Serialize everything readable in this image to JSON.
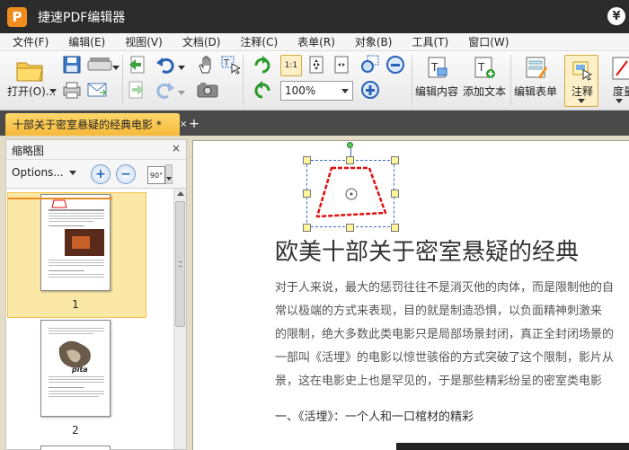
{
  "app": {
    "logo_letter": "P",
    "title": "捷速PDF编辑器",
    "currency_icon": "¥"
  },
  "menu": [
    "文件(F)",
    "编辑(E)",
    "视图(V)",
    "文档(D)",
    "注释(C)",
    "表单(R)",
    "对象(B)",
    "工具(T)",
    "窗口(W)"
  ],
  "toolbar": {
    "open_label": "打开(O)...",
    "zoom_value": "100%",
    "fit_label": "1:1",
    "edit_content_label": "编辑内容",
    "add_text_label": "添加文本",
    "edit_form_label": "编辑表单",
    "annotate_label": "注释",
    "degree_label": "度量"
  },
  "tabs": {
    "active_tab": "十部关于密室悬疑的经典电影 *",
    "close_glyph": "×",
    "add_glyph": "+"
  },
  "thumbnail_panel": {
    "title": "缩略图",
    "close_glyph": "×",
    "options_label": "Options...",
    "rotate_label": "90°",
    "pages": [
      {
        "number": "1",
        "selected": true
      },
      {
        "number": "2",
        "selected": false
      }
    ],
    "thumb2_caption": "pita"
  },
  "document": {
    "title": "欧美十部关于密室悬疑的经典",
    "paragraph": [
      "对于人来说，最大的惩罚往往不是消灭他的肉体，而是限制他的自",
      "常以极端的方式来表现，目的就是制造恐惧，以负面精神刺激来",
      "的限制，绝大多数此类电影只是局部场景封闭，真正全封闭场景的",
      "一部叫《活埋》的电影以惊世骇俗的方式突破了这个限制，影片从",
      "景，这在电影史上也是罕见的，于是那些精彩纷呈的密室类电影"
    ],
    "heading": "一、《活埋》：一个人和一口棺材的精彩"
  },
  "colors": {
    "titlebar": "#2b2b2b",
    "tab_active": "#f5b93a",
    "selection": "#fbe7a6",
    "shape_stroke": "#e01010"
  }
}
